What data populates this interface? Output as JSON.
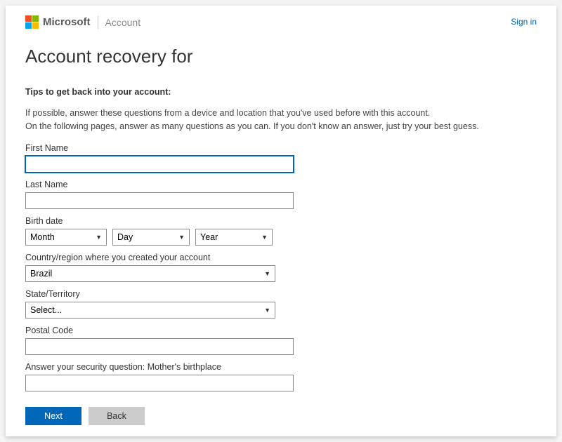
{
  "header": {
    "brand": "Microsoft",
    "product": "Account",
    "signin": "Sign in"
  },
  "title": "Account recovery for",
  "tips": {
    "heading": "Tips to get back into your account:",
    "line1": "If possible, answer these questions from a device and location that you've used before with this account.",
    "line2": "On the following pages, answer as many questions as you can. If you don't know an answer, just try your best guess."
  },
  "labels": {
    "first_name": "First Name",
    "last_name": "Last Name",
    "birth_date": "Birth date",
    "country": "Country/region where you created your account",
    "state": "State/Territory",
    "postal": "Postal Code",
    "security": "Answer your security question: Mother's birthplace"
  },
  "selects": {
    "month": "Month",
    "day": "Day",
    "year": "Year",
    "country_value": "Brazil",
    "state_value": "Select..."
  },
  "buttons": {
    "next": "Next",
    "back": "Back"
  },
  "colors": {
    "primary": "#0067b8"
  }
}
